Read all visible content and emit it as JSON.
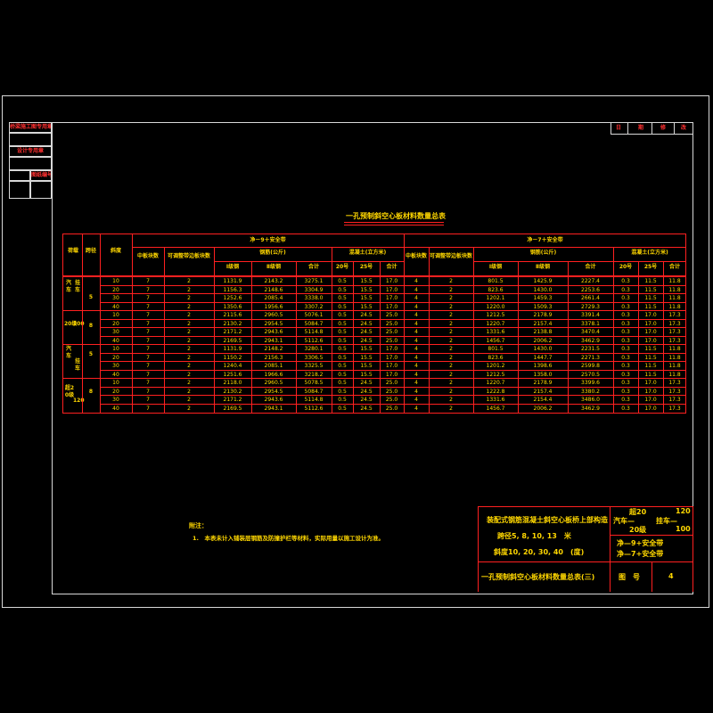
{
  "stamp": {
    "r1": "桥梁施工图专用章",
    "r2": "设计专用章",
    "r3a": "",
    "r3b": "图纸编号"
  },
  "revision": [
    "日",
    "期",
    "修",
    "改"
  ],
  "table_title": "一孔预制斜空心板材料数量总表",
  "headers": {
    "load": "荷载",
    "span": "跨径",
    "skew": "斜度",
    "group1": "净－9＋安全带",
    "group2": "净－7＋安全带",
    "mid": "中板块数",
    "edge": "可调整带边板块数",
    "steel": "钢筋(公斤)",
    "concrete": "混凝土(立方米)",
    "s1": "Ⅰ级钢",
    "s2": "Ⅱ级钢",
    "total": "合计",
    "c20": "20号",
    "c25": "25号"
  },
  "load_labels": {
    "upper_a": "汽车",
    "upper_b": "挂车",
    "upper_c": "20级",
    "upper_d": "100",
    "lower_a": "汽车",
    "lower_b": "挂车",
    "lower_c": "超20级",
    "lower_d": "120"
  },
  "span_labels": [
    "5",
    "8",
    "5",
    "8"
  ],
  "rows": [
    [
      "10",
      "7",
      "2",
      "1131.9",
      "2143.2",
      "3275.1",
      "0.5",
      "15.5",
      "17.0",
      "4",
      "2",
      "801.5",
      "1425.9",
      "2227.4",
      "0.3",
      "11.5",
      "11.8"
    ],
    [
      "20",
      "7",
      "2",
      "1156.3",
      "2148.6",
      "3304.9",
      "0.5",
      "15.5",
      "17.0",
      "4",
      "2",
      "823.6",
      "1430.0",
      "2253.6",
      "0.3",
      "11.5",
      "11.8"
    ],
    [
      "30",
      "7",
      "2",
      "1252.6",
      "2085.4",
      "3338.0",
      "0.5",
      "15.5",
      "17.0",
      "4",
      "2",
      "1202.1",
      "1459.3",
      "2661.4",
      "0.3",
      "11.5",
      "11.8"
    ],
    [
      "40",
      "7",
      "2",
      "1350.6",
      "1956.6",
      "3307.2",
      "0.5",
      "15.5",
      "17.0",
      "4",
      "2",
      "1220.0",
      "1509.3",
      "2729.3",
      "0.3",
      "11.5",
      "11.8"
    ],
    [
      "10",
      "7",
      "2",
      "2115.6",
      "2960.5",
      "5076.1",
      "0.5",
      "24.5",
      "25.0",
      "4",
      "2",
      "1212.5",
      "2178.9",
      "3391.4",
      "0.3",
      "17.0",
      "17.3"
    ],
    [
      "20",
      "7",
      "2",
      "2130.2",
      "2954.5",
      "5084.7",
      "0.5",
      "24.5",
      "25.0",
      "4",
      "2",
      "1220.7",
      "2157.4",
      "3378.1",
      "0.3",
      "17.0",
      "17.3"
    ],
    [
      "30",
      "7",
      "2",
      "2171.2",
      "2943.6",
      "5114.8",
      "0.5",
      "24.5",
      "25.0",
      "4",
      "2",
      "1331.6",
      "2138.8",
      "3470.4",
      "0.3",
      "17.0",
      "17.3"
    ],
    [
      "40",
      "7",
      "2",
      "2169.5",
      "2943.1",
      "5112.6",
      "0.5",
      "24.5",
      "25.0",
      "4",
      "2",
      "1456.7",
      "2006.2",
      "3462.9",
      "0.3",
      "17.0",
      "17.3"
    ],
    [
      "10",
      "7",
      "2",
      "1131.9",
      "2148.2",
      "3280.1",
      "0.5",
      "15.5",
      "17.0",
      "4",
      "2",
      "801.5",
      "1430.0",
      "2231.5",
      "0.3",
      "11.5",
      "11.8"
    ],
    [
      "20",
      "7",
      "2",
      "1150.2",
      "2156.3",
      "3306.5",
      "0.5",
      "15.5",
      "17.0",
      "4",
      "2",
      "823.6",
      "1447.7",
      "2271.3",
      "0.3",
      "11.5",
      "11.8"
    ],
    [
      "30",
      "7",
      "2",
      "1240.4",
      "2085.1",
      "3325.5",
      "0.5",
      "15.5",
      "17.0",
      "4",
      "2",
      "1201.2",
      "1398.6",
      "2599.8",
      "0.3",
      "11.5",
      "11.8"
    ],
    [
      "40",
      "7",
      "2",
      "1251.6",
      "1966.6",
      "3218.2",
      "0.5",
      "15.5",
      "17.0",
      "4",
      "2",
      "1212.5",
      "1358.0",
      "2570.5",
      "0.3",
      "11.5",
      "11.8"
    ],
    [
      "10",
      "7",
      "2",
      "2118.0",
      "2960.5",
      "5078.5",
      "0.5",
      "24.5",
      "25.0",
      "4",
      "2",
      "1220.7",
      "2178.9",
      "3399.6",
      "0.3",
      "17.0",
      "17.3"
    ],
    [
      "20",
      "7",
      "2",
      "2130.2",
      "2954.5",
      "5084.7",
      "0.5",
      "24.5",
      "25.0",
      "4",
      "2",
      "1222.8",
      "2157.4",
      "3380.2",
      "0.3",
      "17.0",
      "17.3"
    ],
    [
      "30",
      "7",
      "2",
      "2171.2",
      "2943.6",
      "5114.8",
      "0.5",
      "24.5",
      "25.0",
      "4",
      "2",
      "1331.6",
      "2154.4",
      "3486.0",
      "0.3",
      "17.0",
      "17.3"
    ],
    [
      "40",
      "7",
      "2",
      "2169.5",
      "2943.1",
      "5112.6",
      "0.5",
      "24.5",
      "25.0",
      "4",
      "2",
      "1456.7",
      "2006.2",
      "3462.9",
      "0.3",
      "17.0",
      "17.3"
    ]
  ],
  "note_title": "附注：",
  "note_1": "1.　本表未计入铺装层钢筋及防撞护栏等材料，实际用量以施工设计为准。",
  "titleblock": {
    "t1": "装配式钢筋混凝土斜空心板桥上部构造",
    "t2": "跨径5, 8, 10, 13　米",
    "t3": "斜度10, 20, 30, 40　(度)",
    "drawing_title": "一孔预制斜空心板材料数量总表(三)",
    "loads_r1a": "超20",
    "loads_r1b": "120",
    "loads_r2a": "汽车—",
    "loads_r2b": "挂车—",
    "loads_r3a": "20级",
    "loads_r3b": "100",
    "lanes_1": "净—9+安全带",
    "lanes_2": "净—7+安全带",
    "fig_label": "图　号",
    "fig_no": "4"
  }
}
